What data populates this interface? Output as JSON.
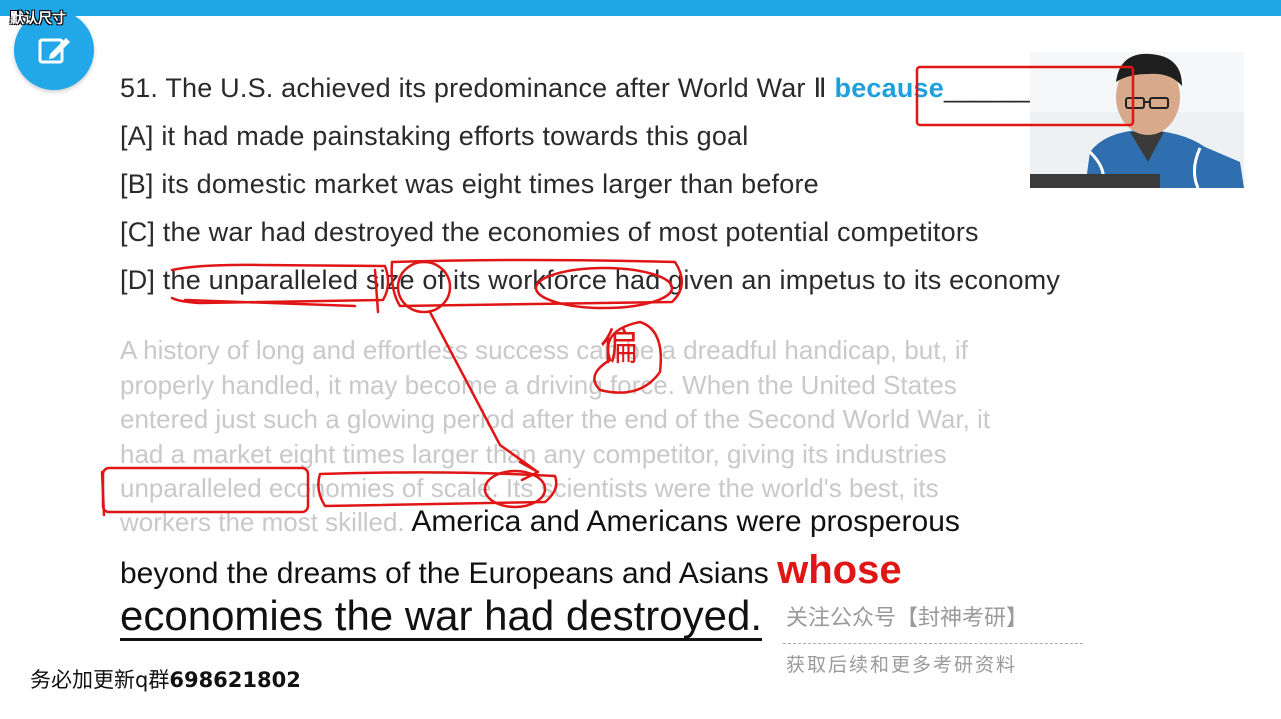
{
  "toolbar": {
    "size_label": "默认尺寸",
    "edit_button_icon": "edit-icon",
    "accent_color": "#1ea7e6"
  },
  "question": {
    "stem": "51. The U.S. achieved its predominance after World War Ⅱ",
    "keyword": "because",
    "blank": "________",
    "options": [
      "[A] it had made painstaking efforts towards this goal",
      "[B] its domestic market was eight times larger than before",
      "[C] the war had destroyed the economies of most potential competitors",
      "[D] the unparalleled size of its workforce had given an impetus to its economy"
    ]
  },
  "annotation": {
    "handwritten_char": "偏",
    "color": "#e01616"
  },
  "passage": {
    "lines": [
      "A history of long and effortless success can be a dreadful handicap, but, if",
      "properly handled, it may become a driving force. When the United States",
      "entered just such a glowing period after the end of the Second World War, it",
      "had a market eight times larger than any competitor, giving its industries",
      "unparalleled economies of scale. Its scientists were the world's best, its"
    ],
    "line6_faded": "workers the most skilled.",
    "line6_dark": " America and Americans were prosperous",
    "line7": "beyond the dreams of the Europeans and Asians ",
    "line7_keyword": "whose",
    "line8": "economies the war had destroyed."
  },
  "watermark": {
    "line1": "关注公众号【封神考研】",
    "line2": "获取后续和更多考研资料"
  },
  "footer": {
    "notice": "务必加更新q群",
    "group_number": "698621802"
  },
  "webcam": {
    "label": "instructor-webcam"
  }
}
